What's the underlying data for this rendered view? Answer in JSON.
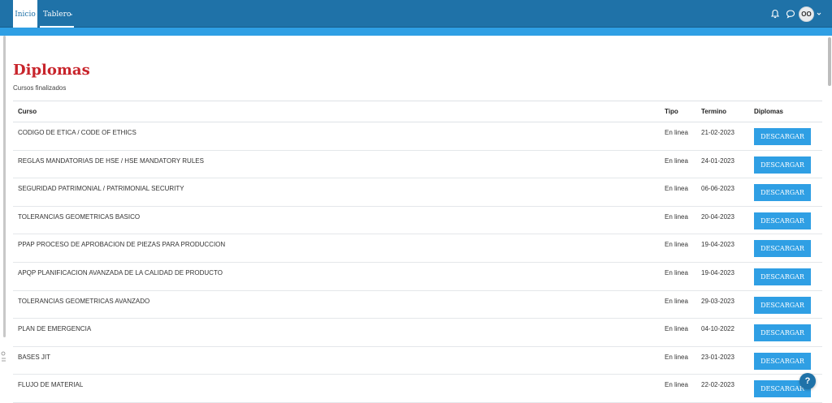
{
  "nav": {
    "tabs": [
      {
        "label": "Inicio"
      },
      {
        "label": "Tablero"
      }
    ],
    "user": {
      "initials": "OO"
    },
    "icons": {
      "notifications": "bell-icon",
      "messages": "chat-icon",
      "user_menu": "chevron-down-icon"
    }
  },
  "page": {
    "title": "Diplomas",
    "subtitle": "Cursos finalizados"
  },
  "table": {
    "headers": [
      "Curso",
      "Tipo",
      "Termino",
      "Diplomas"
    ],
    "rows": [
      {
        "curso": "CODIGO DE ETICA / CODE OF ETHICS",
        "tipo": "En linea",
        "termino": "21-02-2023",
        "action": "DESCARGAR"
      },
      {
        "curso": "REGLAS MANDATORIAS DE HSE / HSE MANDATORY RULES",
        "tipo": "En linea",
        "termino": "24-01-2023",
        "action": "DESCARGAR"
      },
      {
        "curso": "SEGURIDAD PATRIMONIAL / PATRIMONIAL SECURITY",
        "tipo": "En linea",
        "termino": "06-06-2023",
        "action": "DESCARGAR"
      },
      {
        "curso": "TOLERANCIAS GEOMETRICAS BASICO",
        "tipo": "En linea",
        "termino": "20-04-2023",
        "action": "DESCARGAR"
      },
      {
        "curso": "PPAP PROCESO DE APROBACION DE PIEZAS PARA PRODUCCION",
        "tipo": "En linea",
        "termino": "19-04-2023",
        "action": "DESCARGAR"
      },
      {
        "curso": "APQP PLANIFICACION AVANZADA DE LA CALIDAD DE PRODUCTO",
        "tipo": "En linea",
        "termino": "19-04-2023",
        "action": "DESCARGAR"
      },
      {
        "curso": "TOLERANCIAS GEOMETRICAS AVANZADO",
        "tipo": "En linea",
        "termino": "29-03-2023",
        "action": "DESCARGAR"
      },
      {
        "curso": "PLAN DE EMERGENCIA",
        "tipo": "En linea",
        "termino": "04-10-2022",
        "action": "DESCARGAR"
      },
      {
        "curso": "BASES JIT",
        "tipo": "En linea",
        "termino": "23-01-2023",
        "action": "DESCARGAR"
      },
      {
        "curso": "FLUJO DE MATERIAL",
        "tipo": "En linea",
        "termino": "22-02-2023",
        "action": "DESCARGAR"
      }
    ]
  },
  "help": {
    "label": "?"
  },
  "colors": {
    "nav": "#1f72a8",
    "accent": "#2f9fe4",
    "title": "#c8242b",
    "button": "#2f9fe4"
  }
}
